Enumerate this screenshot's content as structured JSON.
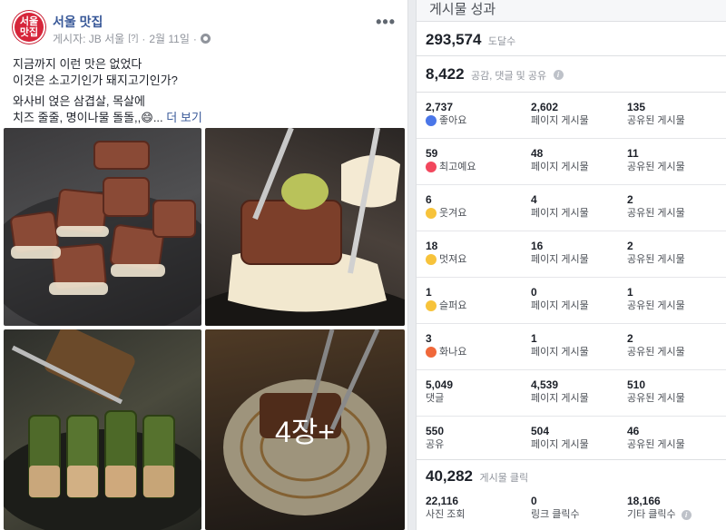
{
  "post": {
    "page_name": "서울 맛집",
    "avatar_text": [
      "서울",
      "맛집"
    ],
    "posted_by": "게시자: JB 서울",
    "help_mark": "[?]",
    "date": "2월 11일",
    "separator": "·",
    "more_menu": "•••",
    "text_lines": [
      "지금까지 이런 맛은 없었다",
      "이것은 소고기인가 돼지고기인가?"
    ],
    "text_lines2": [
      "와사비 얹은 삼겹살, 목살에",
      "치즈 줄줄, 명이나물 돌돌,,😄..."
    ],
    "see_more": "더 보기",
    "more_photos": "4장+"
  },
  "insights": {
    "title": "게시물 성과",
    "reach": {
      "value": "293,574",
      "label": "도달수"
    },
    "engagement": {
      "value": "8,422",
      "label": "공감, 댓글 및 공유",
      "info_icon": "i"
    },
    "rows": [
      {
        "icon": "like-icon",
        "total": "2,737",
        "name": "좋아요",
        "on_post": "2,602",
        "on_post_label": "페이지 게시물",
        "on_shares": "135",
        "on_shares_label": "공유된 게시물"
      },
      {
        "icon": "love-icon",
        "total": "59",
        "name": "최고예요",
        "on_post": "48",
        "on_post_label": "페이지 게시물",
        "on_shares": "11",
        "on_shares_label": "공유된 게시물"
      },
      {
        "icon": "haha-icon",
        "total": "6",
        "name": "웃겨요",
        "on_post": "4",
        "on_post_label": "페이지 게시물",
        "on_shares": "2",
        "on_shares_label": "공유된 게시물"
      },
      {
        "icon": "wow-icon",
        "total": "18",
        "name": "멋져요",
        "on_post": "16",
        "on_post_label": "페이지 게시물",
        "on_shares": "2",
        "on_shares_label": "공유된 게시물"
      },
      {
        "icon": "sad-icon",
        "total": "1",
        "name": "슬퍼요",
        "on_post": "0",
        "on_post_label": "페이지 게시물",
        "on_shares": "1",
        "on_shares_label": "공유된 게시물"
      },
      {
        "icon": "angry-icon",
        "total": "3",
        "name": "화나요",
        "on_post": "1",
        "on_post_label": "페이지 게시물",
        "on_shares": "2",
        "on_shares_label": "공유된 게시물"
      },
      {
        "icon": "",
        "total": "5,049",
        "name": "댓글",
        "on_post": "4,539",
        "on_post_label": "페이지 게시물",
        "on_shares": "510",
        "on_shares_label": "공유된 게시물"
      },
      {
        "icon": "",
        "total": "550",
        "name": "공유",
        "on_post": "504",
        "on_post_label": "페이지 게시물",
        "on_shares": "46",
        "on_shares_label": "공유된 게시물"
      }
    ],
    "post_clicks": {
      "value": "40,282",
      "label": "게시물 클릭"
    },
    "clicks": [
      {
        "value": "22,116",
        "label": "사진 조회"
      },
      {
        "value": "0",
        "label": "링크 클릭수"
      },
      {
        "value": "18,166",
        "label": "기타 클릭수",
        "info_icon": "i"
      }
    ]
  },
  "colors": {
    "link": "#385898",
    "like": "#4a76e8",
    "love": "#f2475d",
    "angry": "#f0683a",
    "avatar": "#d6253a"
  }
}
